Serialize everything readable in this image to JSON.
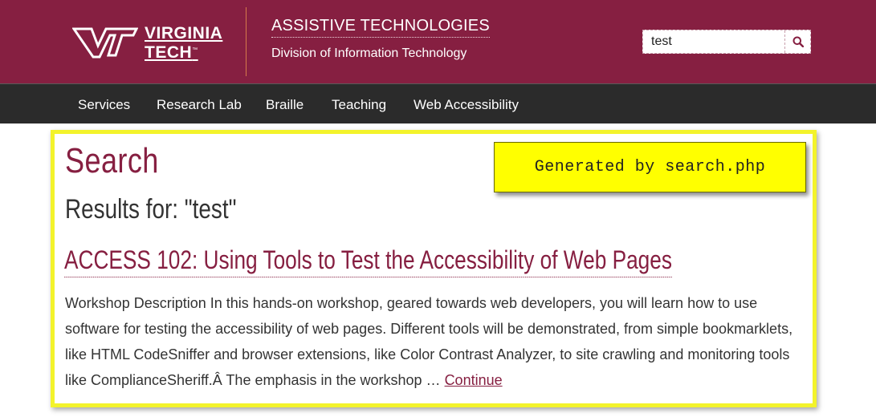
{
  "header": {
    "logo": {
      "line1": "VIRGINIA",
      "line2": "TECH",
      "trademark": "™"
    },
    "site_title": "ASSISTIVE TECHNOLOGIES",
    "site_subtitle": "Division of Information Technology",
    "search": {
      "value": "test",
      "button_icon": "search-icon"
    }
  },
  "nav": {
    "items": [
      {
        "label": "Services"
      },
      {
        "label": "Research Lab"
      },
      {
        "label": "Braille"
      },
      {
        "label": "Teaching"
      },
      {
        "label": "Web Accessibility"
      }
    ]
  },
  "main": {
    "title": "Search",
    "results_heading": "Results for: \"test\"",
    "badge": "Generated by search.php",
    "results": [
      {
        "title": "ACCESS 102: Using Tools to Test the Accessibility of Web Pages",
        "excerpt": "Workshop Description In this hands-on workshop, geared towards web developers, you will learn how to use software for testing the accessibility of web pages. Different tools will be demonstrated, from simple bookmarklets, like HTML CodeSniffer and browser extensions, like Color Contrast Analyzer, to site crawling and monitoring tools like ComplianceSheriff.Â  The emphasis in the workshop … ",
        "continue_label": "Continue"
      }
    ]
  },
  "colors": {
    "brand_maroon": "#861f41",
    "nav_bg": "#2b2b2b",
    "highlight_yellow": "#ffff00",
    "divider_orange": "#d57a4a"
  }
}
